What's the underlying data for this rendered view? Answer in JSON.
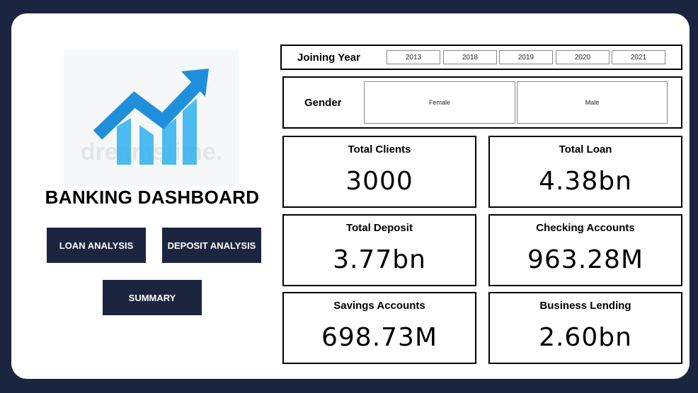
{
  "dashboard": {
    "title": "BANKING DASHBOARD",
    "logo_watermark": "dreamstime."
  },
  "nav": {
    "loan_analysis": "LOAN ANALYSIS",
    "deposit_analysis": "DEPOSIT ANALYSIS",
    "summary": "SUMMARY"
  },
  "filters": {
    "joining_year": {
      "title": "Joining Year",
      "options": [
        "2013",
        "2018",
        "2019",
        "2020",
        "2021"
      ]
    },
    "gender": {
      "title": "Gender",
      "options": [
        "Female",
        "Male"
      ]
    }
  },
  "kpis": {
    "total_clients": {
      "label": "Total Clients",
      "value": "3000"
    },
    "total_loan": {
      "label": "Total Loan",
      "value": "4.38bn"
    },
    "total_deposit": {
      "label": "Total Deposit",
      "value": "3.77bn"
    },
    "checking_accounts": {
      "label": "Checking Accounts",
      "value": "963.28M"
    },
    "savings_accounts": {
      "label": "Savings Accounts",
      "value": "698.73M"
    },
    "business_lending": {
      "label": "Business Lending",
      "value": "2.60bn"
    }
  },
  "colors": {
    "background": "#1c2540",
    "button": "#1c2540",
    "logo_blue": "#1f8fdc",
    "logo_light_blue": "#39b4f0"
  }
}
